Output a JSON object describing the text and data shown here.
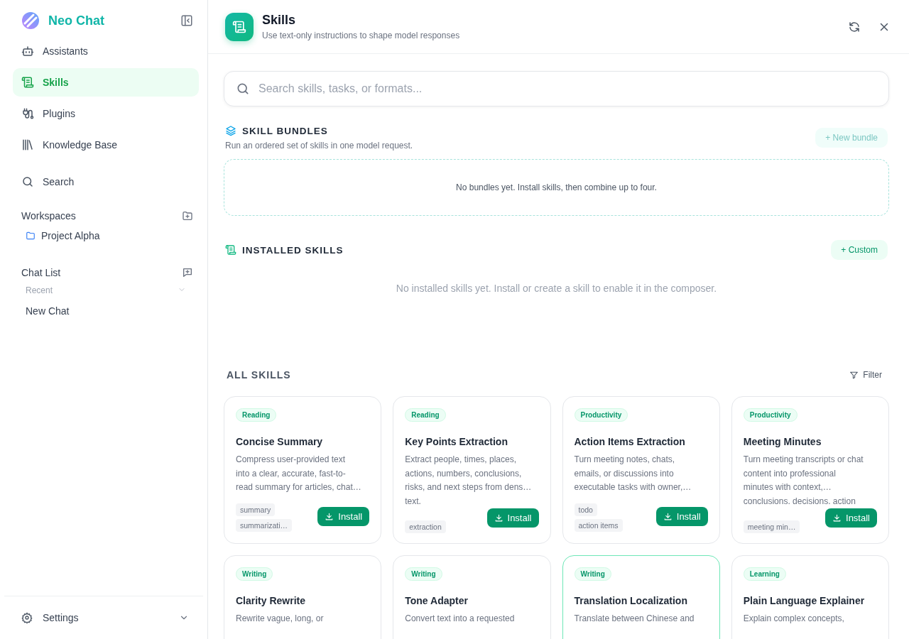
{
  "app": {
    "name": "Neo Chat"
  },
  "sidebar": {
    "nav": [
      {
        "label": "Assistants",
        "selected": false
      },
      {
        "label": "Skills",
        "selected": true
      },
      {
        "label": "Plugins",
        "selected": false
      },
      {
        "label": "Knowledge Base",
        "selected": false
      },
      {
        "label": "Search",
        "selected": false
      }
    ],
    "workspaces": {
      "title": "Workspaces",
      "items": [
        {
          "label": "Project Alpha"
        }
      ]
    },
    "chat_list": {
      "title": "Chat List",
      "group": "Recent",
      "items": [
        {
          "label": "New Chat"
        }
      ]
    },
    "settings": "Settings"
  },
  "header": {
    "title": "Skills",
    "subtitle": "Use text-only instructions to shape model responses"
  },
  "search": {
    "placeholder": "Search skills, tasks, or formats..."
  },
  "bundles": {
    "title": "SKILL BUNDLES",
    "subtitle": "Run an ordered set of skills in one model request.",
    "button": "+ New bundle",
    "empty": "No bundles yet. Install skills, then combine up to four."
  },
  "installed": {
    "title": "INSTALLED SKILLS",
    "button": "+ Custom",
    "empty": "No installed skills yet. Install or create a skill to enable it in the composer."
  },
  "all_skills": {
    "title": "ALL SKILLS",
    "filter": "Filter",
    "cards": [
      {
        "category": "Reading",
        "title": "Concise Summary",
        "description_lines": [
          "Compress user-provided text",
          "into a clear, accurate, fast-to-",
          "read summary for articles, chat…"
        ],
        "tags": [
          "summary",
          "summarizati…"
        ],
        "button": "Install",
        "highlighted": false
      },
      {
        "category": "Reading",
        "title": "Key Points Extraction",
        "description_lines": [
          "Extract people, times, places,",
          "actions, numbers, conclusions,",
          "risks, and next steps from dens…",
          "text."
        ],
        "tags": [
          "extraction"
        ],
        "button": "Install",
        "highlighted": false
      },
      {
        "category": "Productivity",
        "title": "Action Items Extraction",
        "description_lines": [
          "Turn meeting notes, chats,",
          "emails, or discussions into",
          "executable tasks with owner,…"
        ],
        "tags": [
          "todo",
          "action items"
        ],
        "button": "Install",
        "highlighted": false
      },
      {
        "category": "Productivity",
        "title": "Meeting Minutes",
        "description_lines": [
          "Turn meeting transcripts or chat",
          "content into professional",
          "minutes with context,…",
          "conclusions. decisions. action"
        ],
        "tags": [
          "meeting min…"
        ],
        "button": "Install",
        "highlighted": false
      },
      {
        "category": "Writing",
        "title": "Clarity Rewrite",
        "description_lines": [
          "Rewrite vague, long, or"
        ],
        "highlighted": false
      },
      {
        "category": "Writing",
        "title": "Tone Adapter",
        "description_lines": [
          "Convert text into a requested"
        ],
        "highlighted": false
      },
      {
        "category": "Writing",
        "title": "Translation Localization",
        "description_lines": [
          "Translate between Chinese and"
        ],
        "highlighted": true
      },
      {
        "category": "Learning",
        "title": "Plain Language Explainer",
        "description_lines": [
          "Explain complex concepts,"
        ],
        "highlighted": false
      }
    ]
  }
}
